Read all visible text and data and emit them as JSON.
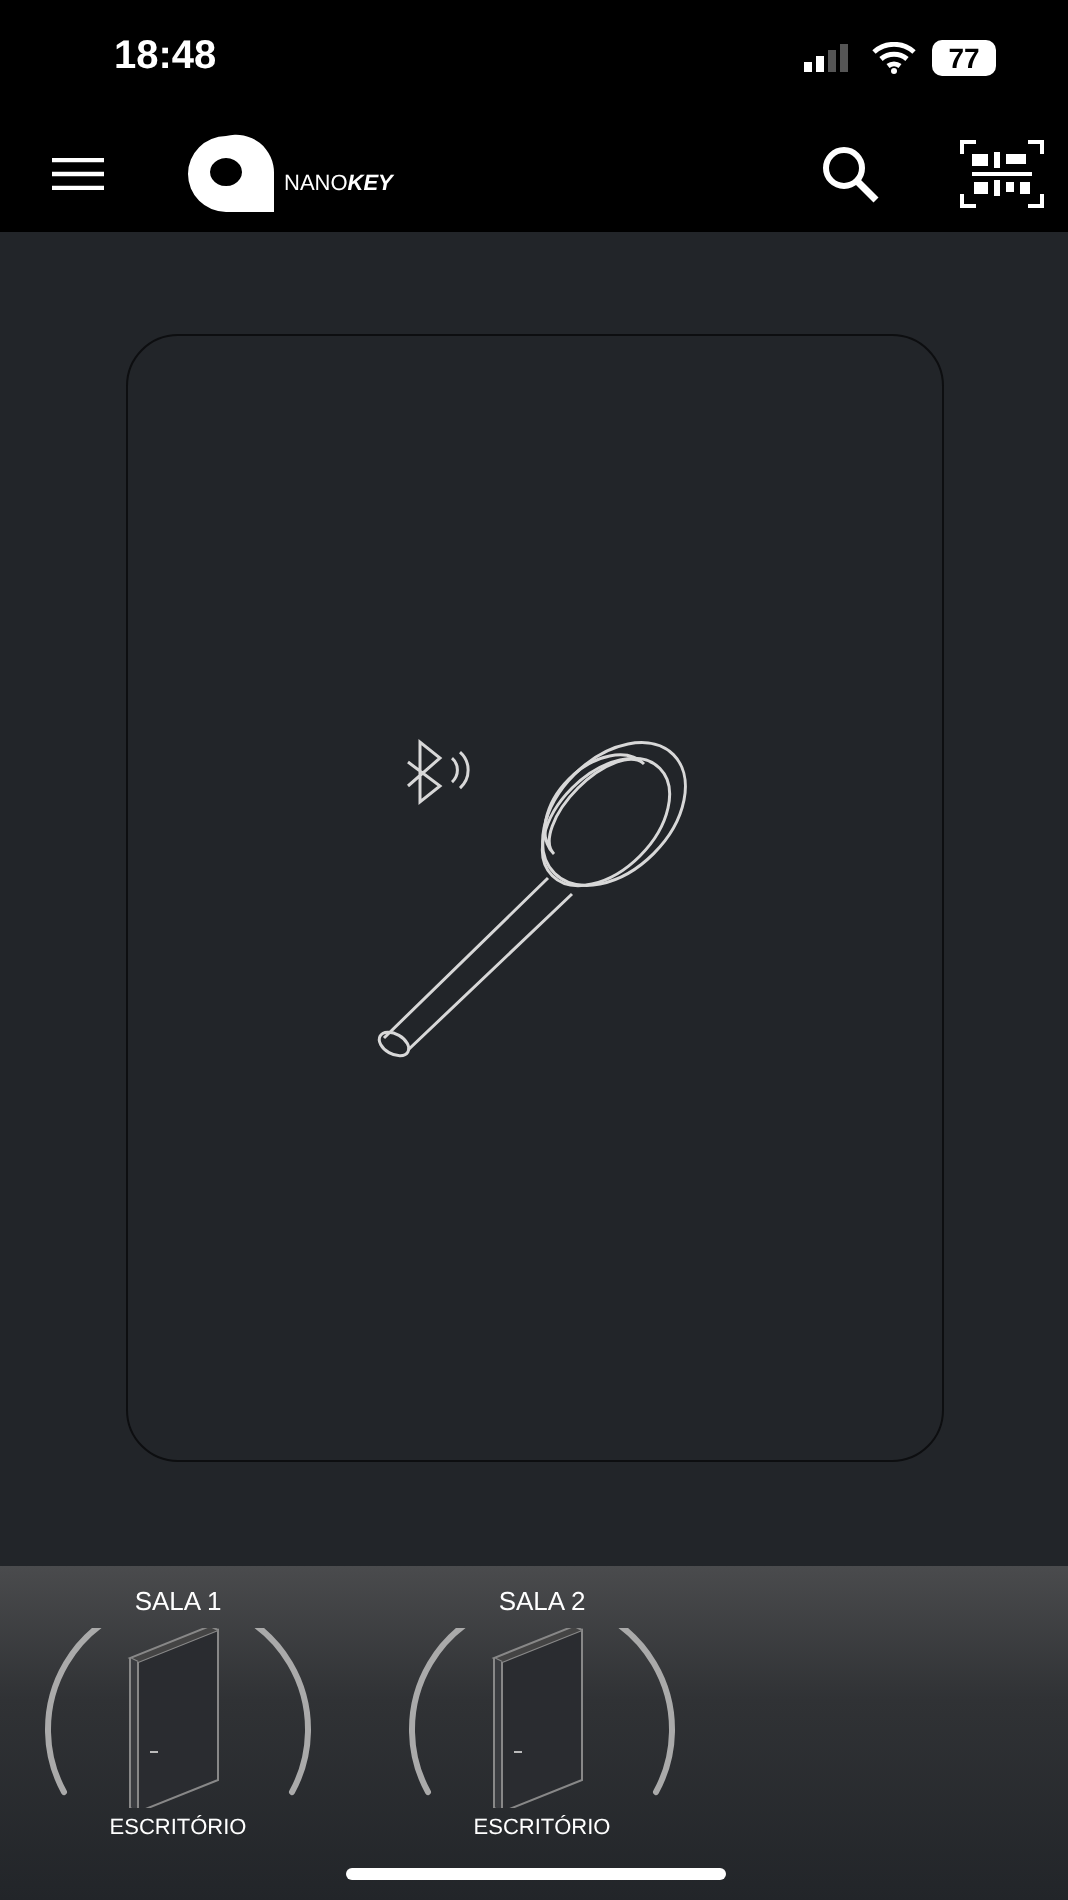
{
  "status_bar": {
    "time": "18:48",
    "battery": "77"
  },
  "header": {
    "logo_light": "NANO",
    "logo_bold": "KEY"
  },
  "locks": [
    {
      "name": "SALA 1",
      "place": "ESCRITÓRIO"
    },
    {
      "name": "SALA 2",
      "place": "ESCRITÓRIO"
    }
  ]
}
